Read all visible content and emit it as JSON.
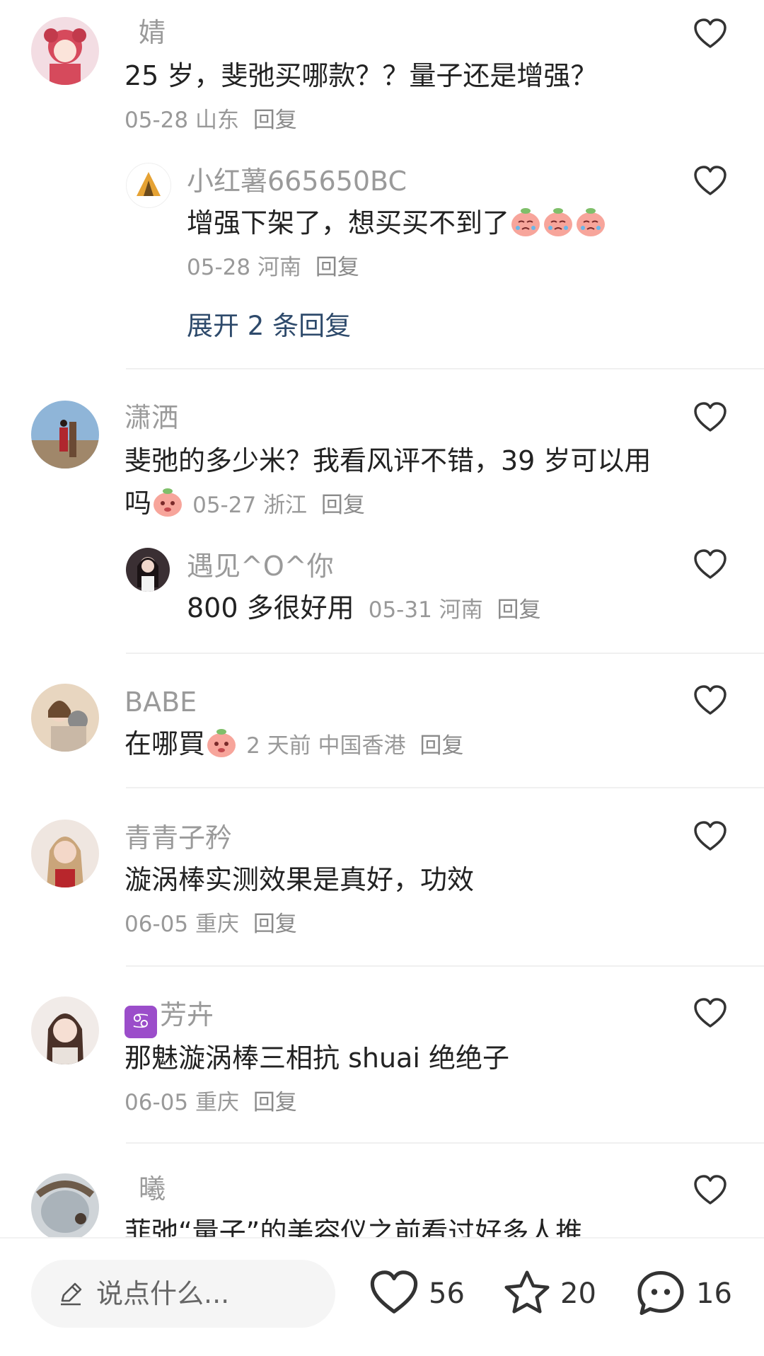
{
  "comments": [
    {
      "name": "婧",
      "text": "25 岁，斐弛买哪款？？量子还是增强？",
      "date": "05-28",
      "location": "山东",
      "reply": "回复"
    },
    {
      "name": "小红薯665650BC",
      "text": "增强下架了，想买买不到了",
      "date": "05-28",
      "location": "河南",
      "reply": "回复",
      "expand": "展开 2 条回复"
    },
    {
      "name": "潇洒",
      "text": "斐弛的多少米？我看风评不错，39 岁可以用",
      "text2": "吗",
      "date": "05-27",
      "location": "浙江",
      "reply": "回复"
    },
    {
      "name": "遇见^O^你",
      "text": "800 多很好用",
      "date": "05-31",
      "location": "河南",
      "reply": "回复"
    },
    {
      "name": "BABE",
      "text": "在哪買",
      "date": "2 天前",
      "location": "中国香港",
      "reply": "回复"
    },
    {
      "name": "青青子矜",
      "text": "漩涡棒实测效果是真好，功效",
      "date": "06-05",
      "location": "重庆",
      "reply": "回复"
    },
    {
      "name": "芳卉",
      "badge": "♋",
      "text": "那魅漩涡棒三相抗 shuai 绝绝子",
      "date": "06-05",
      "location": "重庆",
      "reply": "回复"
    },
    {
      "name": "曦",
      "text": "菲弛“量子”的美容仪之前看过好多人推"
    }
  ],
  "bottom": {
    "placeholder": "说点什么...",
    "likes": "56",
    "favorites": "20",
    "comments": "16"
  },
  "icons": {
    "like": "heart-outline-icon",
    "favorite": "star-outline-icon",
    "comment": "chat-bubble-icon",
    "edit": "pencil-icon",
    "emoji": "peach-cry-emoji",
    "emoji2": "peach-shy-emoji"
  },
  "colors": {
    "username": "#9a9a9a",
    "text": "#222222",
    "meta": "#999999",
    "expand": "#2e4a6b"
  }
}
